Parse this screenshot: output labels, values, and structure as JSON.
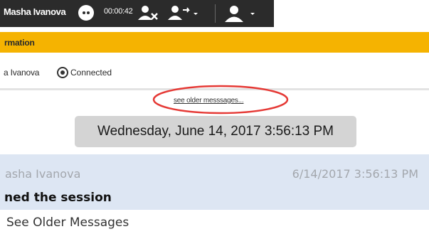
{
  "toolbar": {
    "agent_name": "Masha Ivanova",
    "timer": "00:00:42",
    "icons": [
      "chat-bubble-icon",
      "end-chat-icon",
      "transfer-chat-icon",
      "consult-user-icon"
    ]
  },
  "info_bar": {
    "label": "rmation"
  },
  "status": {
    "participant": "a Ivanova",
    "state": "Connected"
  },
  "older_messages_link": "see older messsages...",
  "date_banner": "Wednesday, June 14, 2017 3:56:13 PM",
  "message": {
    "sender": "asha Ivanova",
    "timestamp": "6/14/2017 3:56:13 PM",
    "text": "ned the session"
  },
  "caption": "See Older Messages",
  "colors": {
    "toolbar": "#2b2b2b",
    "info_bar": "#f5b301",
    "message_bg": "#dde6f3",
    "highlight": "#e53935"
  }
}
